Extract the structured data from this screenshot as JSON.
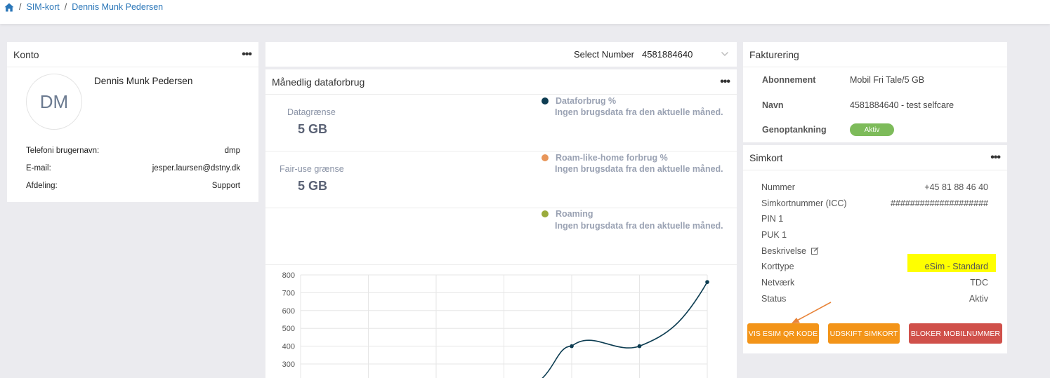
{
  "breadcrumb": {
    "items": [
      "SIM-kort",
      "Dennis Munk Pedersen"
    ]
  },
  "konto": {
    "title": "Konto",
    "initials": "DM",
    "name": "Dennis Munk Pedersen",
    "rows": [
      {
        "label": "Telefoni brugernavn:",
        "value": "dmp"
      },
      {
        "label": "E-mail:",
        "value": "jesper.laursen@dstny.dk"
      },
      {
        "label": "Afdeling:",
        "value": "Support"
      }
    ]
  },
  "select_number": {
    "label": "Select Number",
    "value": "4581884640"
  },
  "usage": {
    "title": "Månedlig dataforbrug",
    "metrics": [
      {
        "label": "Datagrænse",
        "value": "5 GB"
      },
      {
        "label": "Fair-use grænse",
        "value": "5 GB"
      }
    ],
    "legend": [
      {
        "title": "Dataforbrug %",
        "sub": "Ingen brugsdata fra den aktuelle måned.",
        "color": "#0d3d52"
      },
      {
        "title": "Roam-like-home forbrug %",
        "sub": "Ingen brugsdata fra den aktuelle måned.",
        "color": "#e8965a"
      },
      {
        "title": "Roaming",
        "sub": "Ingen brugsdata fra den aktuelle måned.",
        "color": "#9aab3c"
      }
    ]
  },
  "chart_data": {
    "type": "line",
    "yticks": [
      800,
      700,
      600,
      500,
      400,
      300
    ],
    "ylim": [
      300,
      800
    ],
    "x": [
      0,
      1,
      2,
      3,
      4,
      5,
      6
    ],
    "series": [
      {
        "values": [
          null,
          null,
          null,
          null,
          400,
          400,
          760
        ],
        "color": "#0d3d52"
      }
    ]
  },
  "fakturering": {
    "title": "Fakturering",
    "rows": [
      {
        "label": "Abonnement",
        "value": "Mobil Fri Tale/5 GB"
      },
      {
        "label": "Navn",
        "value": "4581884640 - test selfcare"
      },
      {
        "label": "Genoptankning",
        "badge": "Aktiv"
      }
    ]
  },
  "simkort": {
    "title": "Simkort",
    "rows": [
      {
        "label": "Nummer",
        "value": "+45 81 88 46 40"
      },
      {
        "label": "Simkortnummer (ICC)",
        "value": "####################"
      },
      {
        "label": "PIN 1",
        "value": ""
      },
      {
        "label": "PUK 1",
        "value": ""
      },
      {
        "label": "Beskrivelse",
        "value": ""
      },
      {
        "label": "Korttype",
        "value": "eSim - Standard"
      },
      {
        "label": "Netværk",
        "value": "TDC"
      },
      {
        "label": "Status",
        "value": "Aktiv"
      }
    ],
    "buttons": {
      "qr": "VIS ESIM QR KODE",
      "replace": "UDSKIFT SIMKORT",
      "block": "BLOKER MOBILNUMMER"
    },
    "colors": {
      "orange": "#f39418",
      "red": "#d0504a",
      "highlight": "#ffff00"
    }
  }
}
